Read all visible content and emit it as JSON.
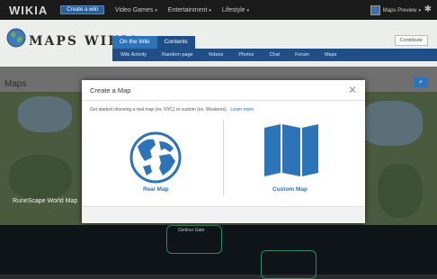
{
  "global_nav": {
    "logo": "WIKIA",
    "create_wiki": "Create a wiki",
    "items": [
      {
        "label": "Video Games"
      },
      {
        "label": "Entertainment"
      },
      {
        "label": "Lifestyle"
      }
    ],
    "user_label": "Maps Preview"
  },
  "wiki": {
    "logo_text": "MAPS WIKIA",
    "tabs": [
      {
        "label": "On the Wiki"
      },
      {
        "label": "Contents"
      }
    ],
    "subnav": [
      "Wiki Activity",
      "Random page",
      "Videos",
      "Photos",
      "Chat",
      "Forum",
      "Maps"
    ],
    "contribute": "Contribute"
  },
  "page": {
    "title": "Maps",
    "bg_map_label": "RuneScape World Map",
    "lower_map_label": "Gielinor Gate"
  },
  "modal": {
    "title": "Create a Map",
    "intro": "Get started choosing a real map (ex. NYC) or custom (ex. Westeros).",
    "learn_more": "Learn more",
    "options": [
      {
        "label": "Real Map"
      },
      {
        "label": "Custom Map"
      }
    ]
  },
  "colors": {
    "accent": "#2c73b7",
    "nav_dark": "#1f4f86"
  }
}
